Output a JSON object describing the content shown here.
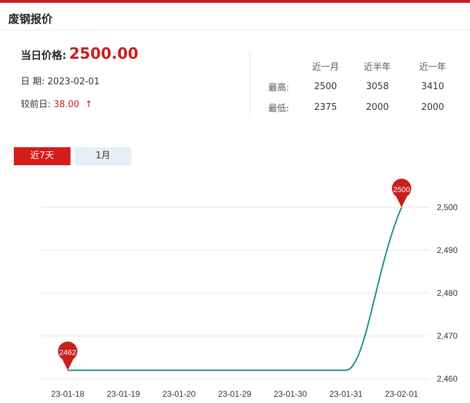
{
  "header": {
    "title": "废钢报价"
  },
  "summary": {
    "price_label": "当日价格:",
    "price_value": "2500.00",
    "date_label": "日 期:",
    "date_value": "2023-02-01",
    "change_label": "较前日:",
    "change_value": "38.00",
    "change_arrow": "↑"
  },
  "stats": {
    "headers": [
      "近一月",
      "近半年",
      "近一年"
    ],
    "rows": [
      {
        "label": "最高:",
        "values": [
          "2500",
          "3058",
          "3410"
        ]
      },
      {
        "label": "最低:",
        "values": [
          "2375",
          "2000",
          "2000"
        ]
      }
    ]
  },
  "tabs": [
    "近7天",
    "1月"
  ],
  "colors": {
    "accent": "#c81e1e",
    "line": "#1a8a87",
    "tab_active": "#d61b1b",
    "tab_inactive": "#e6eef6"
  },
  "chart_data": {
    "type": "line",
    "x": [
      "23-01-18",
      "23-01-19",
      "23-01-20",
      "23-01-29",
      "23-01-30",
      "23-01-31",
      "23-02-01"
    ],
    "values": [
      2462,
      2462,
      2462,
      2462,
      2462,
      2462,
      2500
    ],
    "ylim": [
      2460,
      2500
    ],
    "yticks": [
      "2,460",
      "2,470",
      "2,480",
      "2,490",
      "2,500"
    ],
    "point_labels": [
      {
        "x": "23-01-18",
        "label": "2462"
      },
      {
        "x": "23-02-01",
        "label": "2500"
      }
    ],
    "grid": true,
    "ylabel_position": "right"
  }
}
